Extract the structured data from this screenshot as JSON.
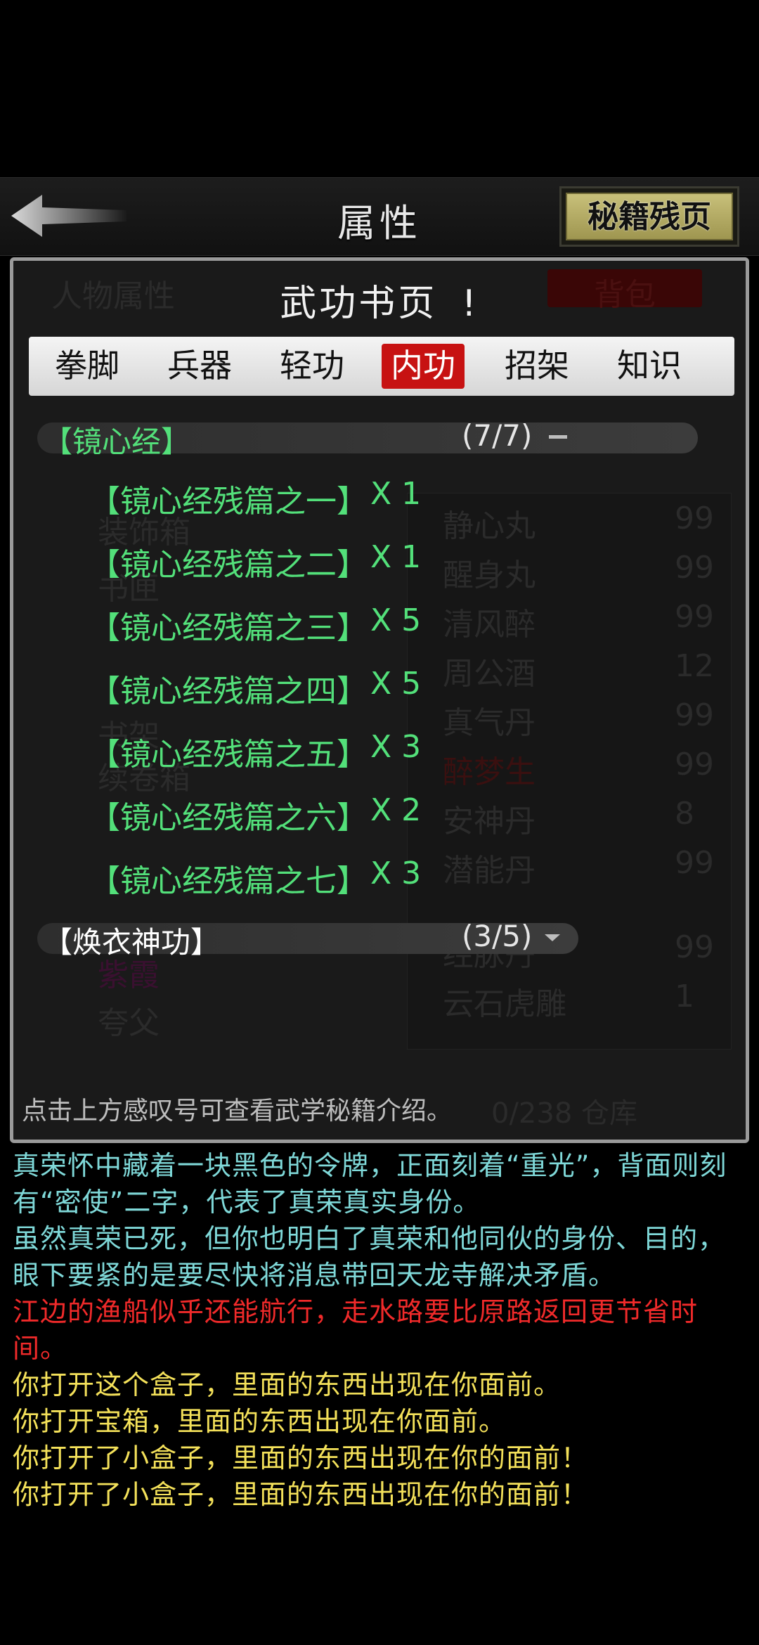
{
  "header": {
    "title": "属性",
    "fragments_button": "秘籍残页"
  },
  "panel": {
    "title": "武功书页",
    "info_mark": "!",
    "tabs": [
      "拳脚",
      "兵器",
      "轻功",
      "内功",
      "招架",
      "知识"
    ],
    "active_tab": "内功",
    "sections": [
      {
        "name": "【镜心经】",
        "count": "(7/7)",
        "expanded": true,
        "entries": [
          {
            "name": "【镜心经残篇之一】",
            "qty": "X 1"
          },
          {
            "name": "【镜心经残篇之二】",
            "qty": "X 1"
          },
          {
            "name": "【镜心经残篇之三】",
            "qty": "X 5"
          },
          {
            "name": "【镜心经残篇之四】",
            "qty": "X 5"
          },
          {
            "name": "【镜心经残篇之五】",
            "qty": "X 3"
          },
          {
            "name": "【镜心经残篇之六】",
            "qty": "X 2"
          },
          {
            "name": "【镜心经残篇之七】",
            "qty": "X 3"
          }
        ]
      },
      {
        "name": "【焕衣神功】",
        "count": "(3/5)",
        "expanded": false
      }
    ],
    "hint": "点击上方感叹号可查看武学秘籍介绍。"
  },
  "background_panel": {
    "tab_attributes": "人物属性",
    "tab_bag": "背包",
    "items": [
      "静心丸",
      "醒身丸",
      "清风醉",
      "周公酒",
      "真气丹",
      "醉梦生",
      "安神丹",
      "潜能丹",
      "经脉丹",
      "云石虎雕"
    ],
    "counts": [
      "99",
      "99",
      "99",
      "12",
      "99",
      "99",
      "8",
      "99",
      "99",
      "1"
    ],
    "left_items": [
      "装饰箱",
      "书匣",
      "书架",
      "续卷箱",
      "紫霞",
      "夸父"
    ],
    "storage": "0/238 仓库"
  },
  "log": [
    {
      "text": "真荣怀中藏着一块黑色的令牌，正面刻着“重光”，背面则刻有“密使”二字，代表了真荣真实身份。",
      "color": "blue"
    },
    {
      "text": "虽然真荣已死，但你也明白了真荣和他同伙的身份、目的，眼下要紧的是要尽快将消息带回天龙寺解决矛盾。",
      "color": "blue"
    },
    {
      "text": "江边的渔船似乎还能航行，走水路要比原路返回更节省时间。",
      "color": "red"
    },
    {
      "text": "你打开这个盒子，里面的东西出现在你面前。",
      "color": "yellow"
    },
    {
      "text": "你打开宝箱，里面的东西出现在你面前。",
      "color": "yellow"
    },
    {
      "text": "你打开了小盒子，里面的东西出现在你的面前！",
      "color": "yellow"
    },
    {
      "text": "你打开了小盒子，里面的东西出现在你的面前！",
      "color": "yellow"
    }
  ],
  "colors": {
    "active_tab": "#c71212",
    "entry_green": "#53e07a",
    "log_blue": "#7fd8d8",
    "log_red": "#f02a2a",
    "log_yellow": "#f4e15a"
  }
}
